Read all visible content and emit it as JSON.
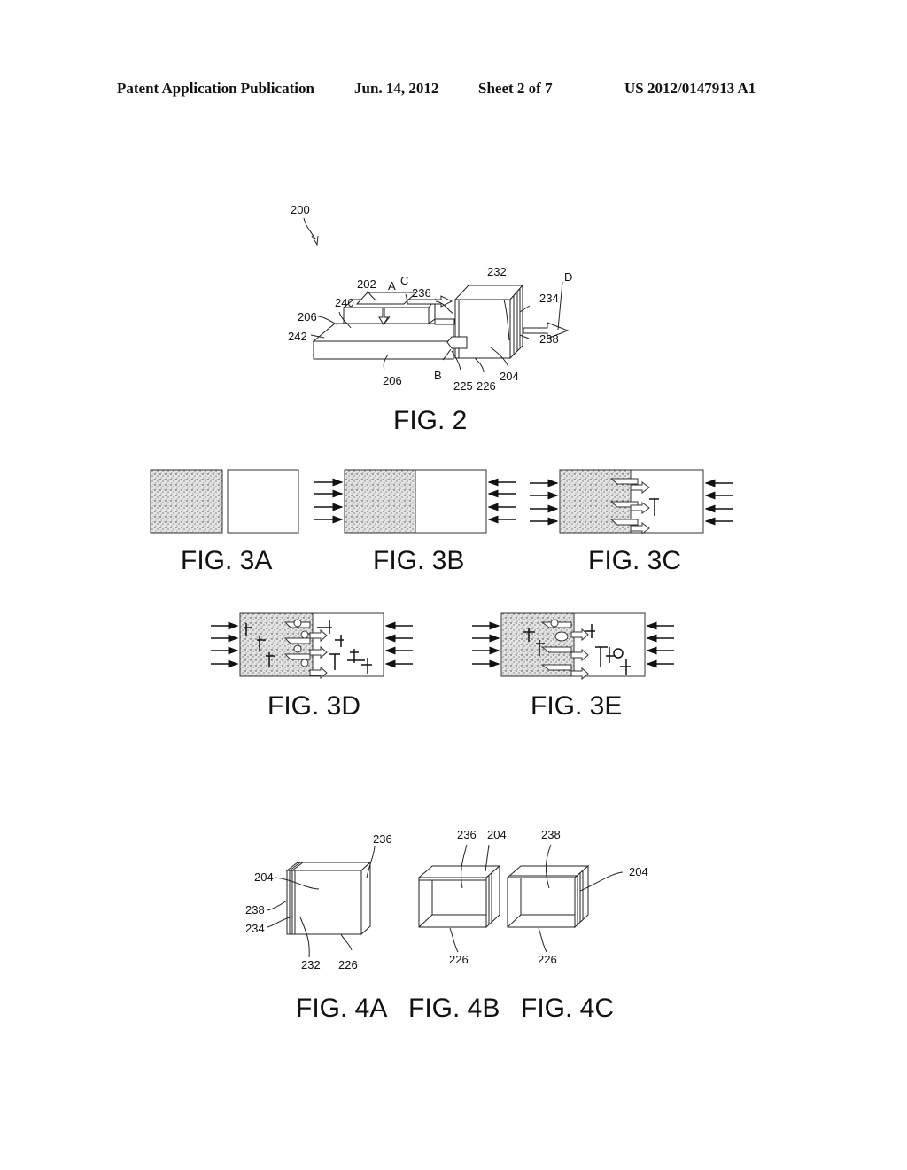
{
  "header": {
    "publication": "Patent Application Publication",
    "date": "Jun. 14, 2012",
    "sheet": "Sheet 2 of 7",
    "number": "US 2012/0147913 A1"
  },
  "fig2": {
    "caption": "FIG. 2",
    "refs": {
      "r200": "200",
      "r202": "202",
      "r240": "240",
      "r206a": "206",
      "r242": "242",
      "r206b": "206",
      "rA": "A",
      "rC": "C",
      "r236": "236",
      "r232": "232",
      "r234": "234",
      "rD": "D",
      "r238": "238",
      "rB": "B",
      "r225": "225",
      "r226": "226",
      "r204": "204"
    }
  },
  "fig3": {
    "a": "FIG. 3A",
    "b": "FIG. 3B",
    "c": "FIG. 3C",
    "d": "FIG. 3D",
    "e": "FIG. 3E"
  },
  "fig4": {
    "a": "FIG. 4A",
    "b": "FIG. 4B",
    "c": "FIG. 4C",
    "a_refs": {
      "r236": "236",
      "r204": "204",
      "r238": "238",
      "r234": "234",
      "r232": "232",
      "r226": "226"
    },
    "b_refs": {
      "r236": "236",
      "r204": "204",
      "r226": "226"
    },
    "c_refs": {
      "r238": "238",
      "r204": "204",
      "r226": "226"
    }
  }
}
